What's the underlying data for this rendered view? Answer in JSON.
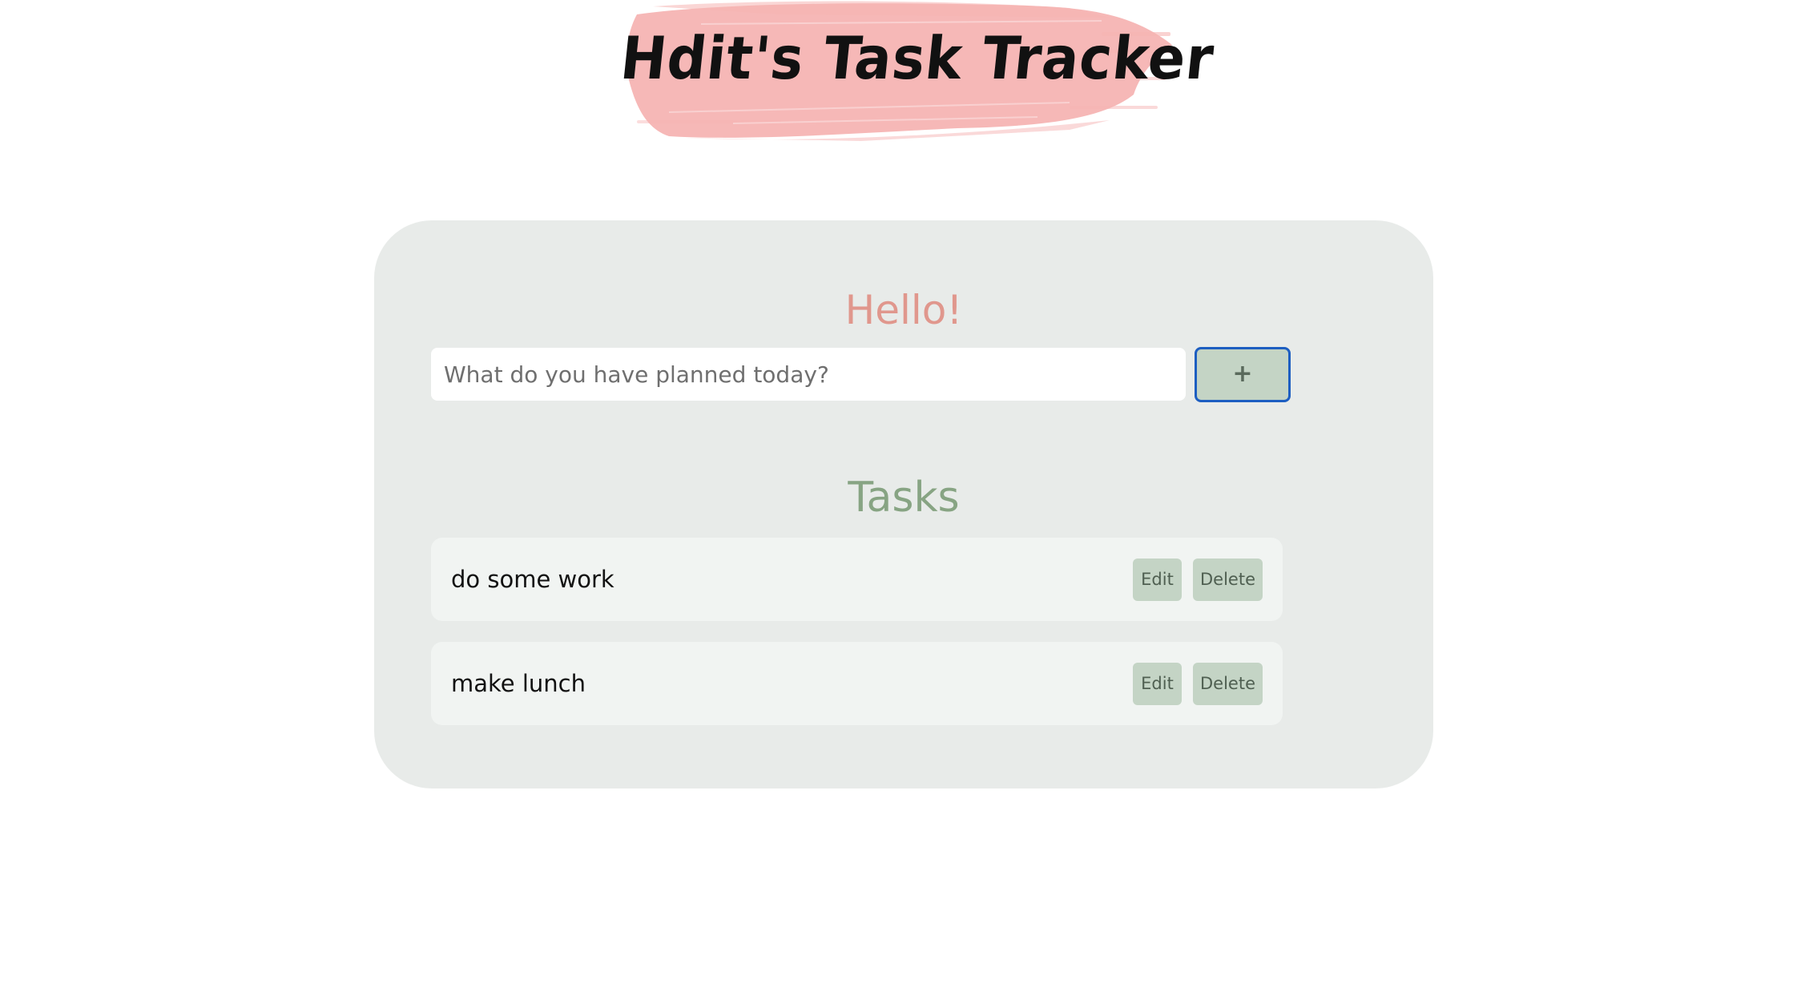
{
  "header": {
    "title": "Hdit's Task Tracker",
    "brush_color": "#f6b4b3"
  },
  "card": {
    "greeting": "Hello!",
    "input": {
      "placeholder": "What do you have planned today?",
      "value": ""
    },
    "add_button_label": "+",
    "tasks_heading": "Tasks",
    "tasks": [
      {
        "label": "do some work",
        "edit_label": "Edit",
        "delete_label": "Delete"
      },
      {
        "label": "make lunch",
        "edit_label": "Edit",
        "delete_label": "Delete"
      }
    ]
  },
  "colors": {
    "card_background": "#e8ebe9",
    "greeting": "#e0978d",
    "tasks_heading": "#87a483",
    "button_background": "#c4d4c5",
    "focus_outline": "#1d5ec1"
  }
}
